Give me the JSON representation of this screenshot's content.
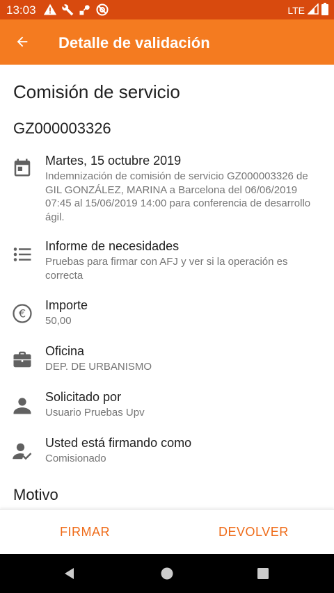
{
  "status_bar": {
    "time": "13:03",
    "network": "LTE",
    "icons": [
      "warning-icon",
      "wrench-icon",
      "tools-icon",
      "at-sign-icon"
    ]
  },
  "app_bar": {
    "title": "Detalle de validación",
    "back_icon": "arrow-back-icon"
  },
  "detail": {
    "title": "Comisión de servicio",
    "code": "GZ000003326",
    "rows": [
      {
        "icon": "calendar-icon",
        "primary": "Martes, 15 octubre 2019",
        "secondary": "Indemnización de comisión de servicio GZ000003326 de GIL GONZÁLEZ, MARINA a Barcelona del 06/06/2019 07:45 al 15/06/2019 14:00 para conferencia de desarrollo ágil."
      },
      {
        "icon": "list-icon",
        "primary": "Informe de necesidades",
        "secondary": "Pruebas para firmar con AFJ y ver si la operación es correcta"
      },
      {
        "icon": "euro-icon",
        "primary": "Importe",
        "secondary": "50,00"
      },
      {
        "icon": "briefcase-icon",
        "primary": "Oficina",
        "secondary": "DEP. DE URBANISMO"
      },
      {
        "icon": "person-icon",
        "primary": "Solicitado por",
        "secondary": "Usuario Pruebas Upv"
      },
      {
        "icon": "person-check-icon",
        "primary": "Usted está firmando como",
        "secondary": "Comisionado"
      }
    ],
    "motivo_label": "Motivo"
  },
  "actions": {
    "sign_label": "FIRMAR",
    "return_label": "DEVOLVER"
  },
  "colors": {
    "status_bar": "#d84a0e",
    "app_bar": "#f47b20",
    "accent": "#ef6c1a"
  }
}
